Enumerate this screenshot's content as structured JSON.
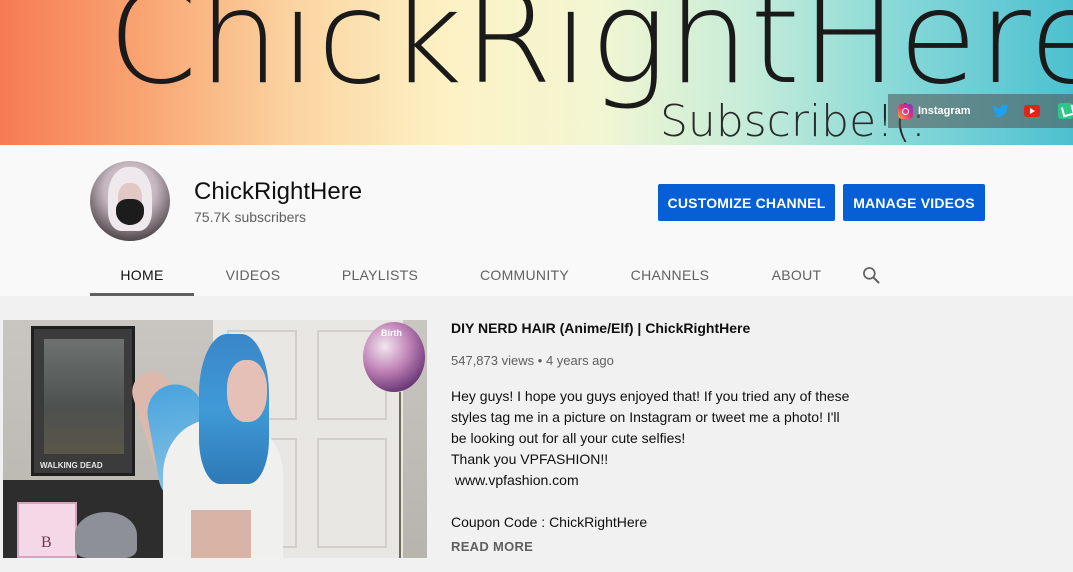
{
  "banner": {
    "title": "ChickRightHere",
    "subtitle": "Subscribe!(:",
    "links": {
      "instagram_label": "Instagram"
    }
  },
  "channel": {
    "name": "ChickRightHere",
    "subscribers": "75.7K subscribers"
  },
  "buttons": {
    "customize": "CUSTOMIZE CHANNEL",
    "manage": "MANAGE VIDEOS"
  },
  "tabs": [
    "HOME",
    "VIDEOS",
    "PLAYLISTS",
    "COMMUNITY",
    "CHANNELS",
    "ABOUT"
  ],
  "active_tab": "HOME",
  "featured": {
    "title": "DIY NERD HAIR (Anime/Elf) | ChickRightHere",
    "views": "547,873 views",
    "age": "4 years ago",
    "separator": "•",
    "description": [
      "Hey guys! I hope you guys enjoyed that! If you tried any of these",
      "styles tag me in a picture on Instagram or tweet me a photo! I'll",
      "be looking out for all your cute selfies!",
      "Thank you VPFASHION!!",
      " www.vpfashion.com",
      "",
      "Coupon Code : ChickRightHere"
    ],
    "read_more": "READ MORE",
    "thumbnail_texts": {
      "poster": "WALKING DEAD",
      "balloon": "Birth",
      "pillow": "B"
    }
  },
  "colors": {
    "accent": "#065fd4",
    "page_bg": "#f1f1f1",
    "header_bg": "#f9f9f9"
  },
  "icons": [
    "instagram-icon",
    "twitter-icon",
    "youtube-icon",
    "vine-icon",
    "search-icon"
  ]
}
